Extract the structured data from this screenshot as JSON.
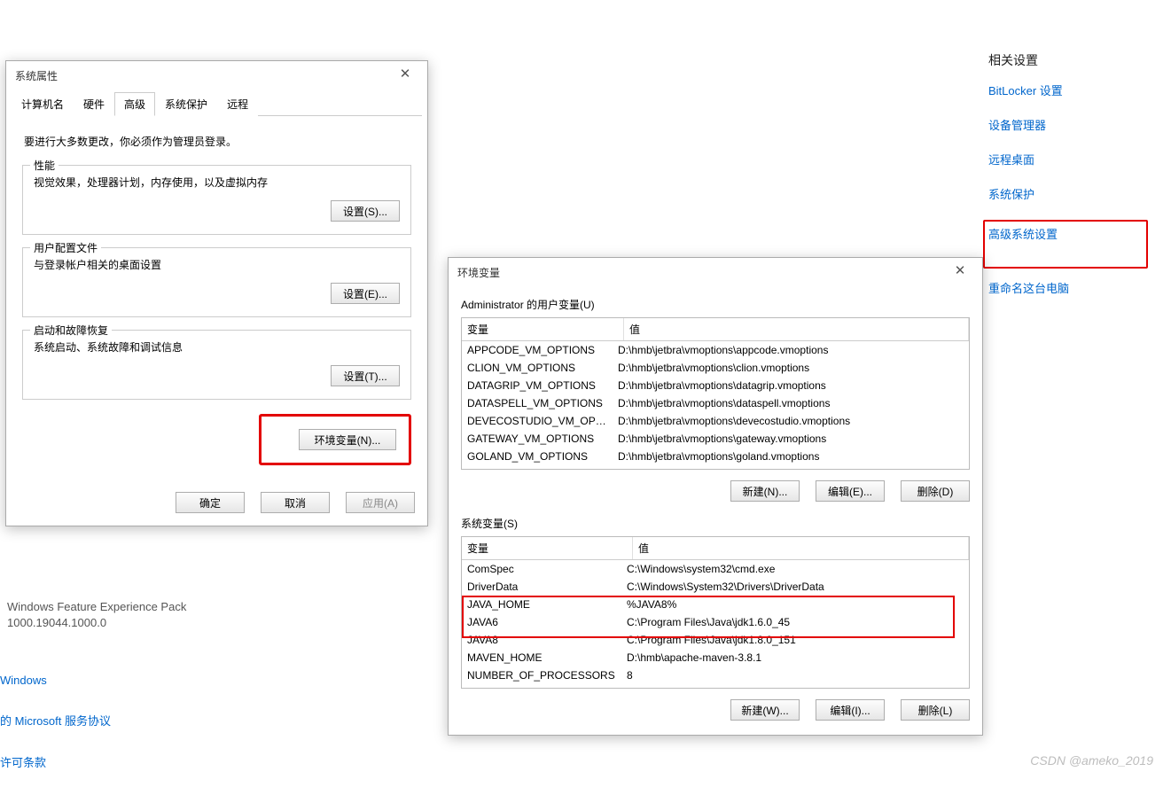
{
  "right": {
    "heading": "相关设置",
    "links": [
      "BitLocker 设置",
      "设备管理器",
      "远程桌面",
      "系统保护",
      "高级系统设置",
      "重命名这台电脑"
    ],
    "highlight_index": 4
  },
  "feature_pack": {
    "line1": "Windows Feature Experience Pack",
    "line2": "1000.19044.1000.0"
  },
  "bottom_links": [
    "Windows",
    "的 Microsoft 服务协议",
    "许可条款"
  ],
  "sysprop": {
    "title": "系统属性",
    "tabs": [
      "计算机名",
      "硬件",
      "高级",
      "系统保护",
      "远程"
    ],
    "active_tab": 2,
    "intro": "要进行大多数更改，你必须作为管理员登录。",
    "groups": [
      {
        "legend": "性能",
        "desc": "视觉效果，处理器计划，内存使用，以及虚拟内存",
        "btn": "设置(S)..."
      },
      {
        "legend": "用户配置文件",
        "desc": "与登录帐户相关的桌面设置",
        "btn": "设置(E)..."
      },
      {
        "legend": "启动和故障恢复",
        "desc": "系统启动、系统故障和调试信息",
        "btn": "设置(T)..."
      }
    ],
    "env_btn": "环境变量(N)...",
    "ok": "确定",
    "cancel": "取消",
    "apply": "应用(A)"
  },
  "envvar": {
    "title": "环境变量",
    "user_label": "Administrator 的用户变量(U)",
    "sys_label": "系统变量(S)",
    "col_var": "变量",
    "col_val": "值",
    "user_rows": [
      [
        "APPCODE_VM_OPTIONS",
        "D:\\hmb\\jetbra\\vmoptions\\appcode.vmoptions"
      ],
      [
        "CLION_VM_OPTIONS",
        "D:\\hmb\\jetbra\\vmoptions\\clion.vmoptions"
      ],
      [
        "DATAGRIP_VM_OPTIONS",
        "D:\\hmb\\jetbra\\vmoptions\\datagrip.vmoptions"
      ],
      [
        "DATASPELL_VM_OPTIONS",
        "D:\\hmb\\jetbra\\vmoptions\\dataspell.vmoptions"
      ],
      [
        "DEVECOSTUDIO_VM_OPT...",
        "D:\\hmb\\jetbra\\vmoptions\\devecostudio.vmoptions"
      ],
      [
        "GATEWAY_VM_OPTIONS",
        "D:\\hmb\\jetbra\\vmoptions\\gateway.vmoptions"
      ],
      [
        "GOLAND_VM_OPTIONS",
        "D:\\hmb\\jetbra\\vmoptions\\goland.vmoptions"
      ]
    ],
    "sys_rows": [
      [
        "ComSpec",
        "C:\\Windows\\system32\\cmd.exe"
      ],
      [
        "DriverData",
        "C:\\Windows\\System32\\Drivers\\DriverData"
      ],
      [
        "JAVA_HOME",
        "%JAVA8%"
      ],
      [
        "JAVA6",
        "C:\\Program Files\\Java\\jdk1.6.0_45"
      ],
      [
        "JAVA8",
        "C:\\Program Files\\Java\\jdk1.8.0_151"
      ],
      [
        "MAVEN_HOME",
        "D:\\hmb\\apache-maven-3.8.1"
      ],
      [
        "NUMBER_OF_PROCESSORS",
        "8"
      ]
    ],
    "new_u": "新建(N)...",
    "edit_u": "编辑(E)...",
    "del_u": "删除(D)",
    "new_s": "新建(W)...",
    "edit_s": "编辑(I)...",
    "del_s": "删除(L)"
  },
  "watermark": "CSDN @ameko_2019"
}
